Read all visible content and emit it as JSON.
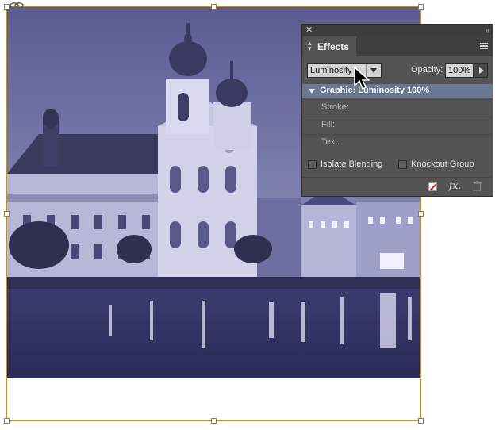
{
  "panel": {
    "tab_label": "Effects",
    "blend_mode_value": "Luminosity",
    "opacity_label": "Opacity:",
    "opacity_value": "100%",
    "graphic_row_label": "Graphic: Luminosity 100%",
    "attributes": [
      "Stroke:",
      "Fill:",
      "Text:"
    ],
    "isolate_blending_label": "Isolate Blending",
    "knockout_group_label": "Knockout Group",
    "isolate_blending_checked": false,
    "knockout_group_checked": false
  },
  "icons": {
    "close": "close-icon",
    "collapse": "collapse-icon",
    "panel_menu": "menu-icon",
    "clear_effects": "clear-effects-icon",
    "fx": "fx-icon",
    "trash": "trash-icon",
    "cursor": "cursor-icon",
    "link": "link-icon"
  },
  "colors": {
    "panel_bg": "#535353",
    "selected_row": "#6a7790",
    "frame_border": "#b8922a",
    "photo_tint": "#4a4a80"
  }
}
